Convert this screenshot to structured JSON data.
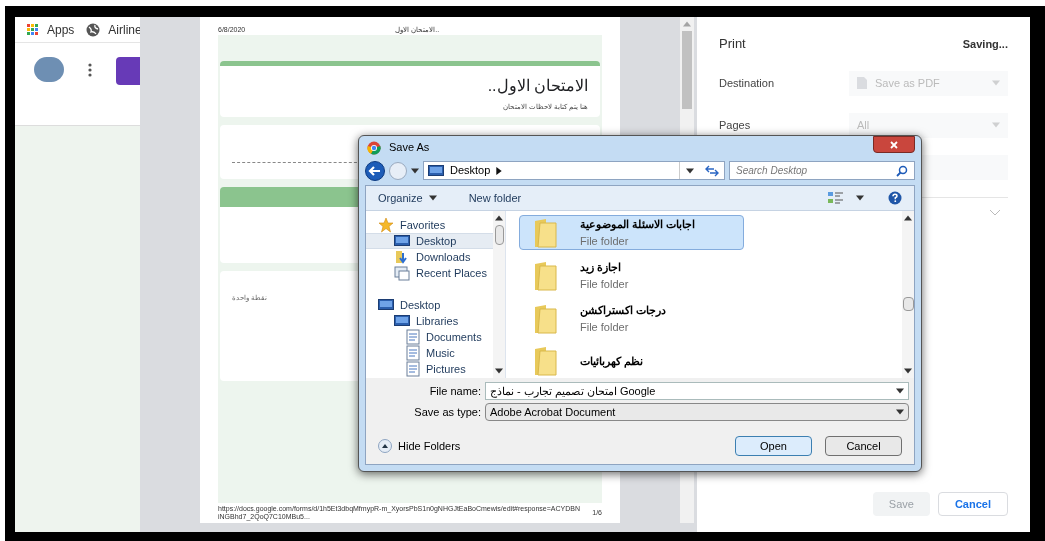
{
  "browser": {
    "bookmarks": [
      {
        "label": "Apps"
      },
      {
        "label": "Airline"
      }
    ]
  },
  "preview_page": {
    "date": "6/8/2020",
    "header_title": "..الامتحان الاول",
    "form_title": "الامتحان الاول..",
    "form_description": "هنا يتم كتابة لاحظات الامتحان",
    "question_points": "نقطة واحدة",
    "footer_url": "https://docs.google.com/forms/d/1h5Et3dbqMfmypR-m_XyorsPbS1n0gNHGJtEaBoCmewis/edit#response=ACYDBNiNGBhd7_2QoQ7C10MBu5...",
    "page_number": "1/6"
  },
  "print_panel": {
    "title": "Print",
    "status": "Saving...",
    "settings": [
      {
        "label": "Destination",
        "value": "Save as PDF"
      },
      {
        "label": "Pages",
        "value": "All"
      }
    ],
    "buttons": [
      {
        "label": "Save",
        "disabled": true
      },
      {
        "label": "Cancel",
        "disabled": false
      }
    ]
  },
  "save_dialog": {
    "title": "Save As",
    "location": "Desktop",
    "search_placeholder": "Search Desktop",
    "toolbar": [
      "Organize",
      "New folder"
    ],
    "nav": [
      {
        "label": "Favorites",
        "selected": false,
        "children": [
          {
            "label": "Desktop",
            "selected": true
          },
          {
            "label": "Downloads",
            "selected": false
          },
          {
            "label": "Recent Places",
            "selected": false
          }
        ]
      },
      {
        "label": "Desktop",
        "selected": false,
        "children": [
          {
            "label": "Libraries",
            "selected": false,
            "children": [
              {
                "label": "Documents",
                "selected": false
              },
              {
                "label": "Music",
                "selected": false
              },
              {
                "label": "Pictures",
                "selected": false
              }
            ]
          }
        ]
      }
    ],
    "files": [
      {
        "name": "اجابات الاسئلة الموضوعية",
        "type": "File folder",
        "selected": true
      },
      {
        "name": "اجازة زيد",
        "type": "File folder",
        "selected": false
      },
      {
        "name": "درجات اكستراكشن",
        "type": "File folder",
        "selected": false
      },
      {
        "name": "نظم كهربائيات",
        "selected": false
      }
    ],
    "file_name": {
      "label": "File name:",
      "value": "امتحان تصميم تجارب - نماذج Google"
    },
    "save_type": {
      "label": "Save as type:",
      "value": "Adobe Acrobat Document"
    },
    "hide_folders": "Hide Folders",
    "buttons": [
      "Open",
      "Cancel"
    ]
  }
}
